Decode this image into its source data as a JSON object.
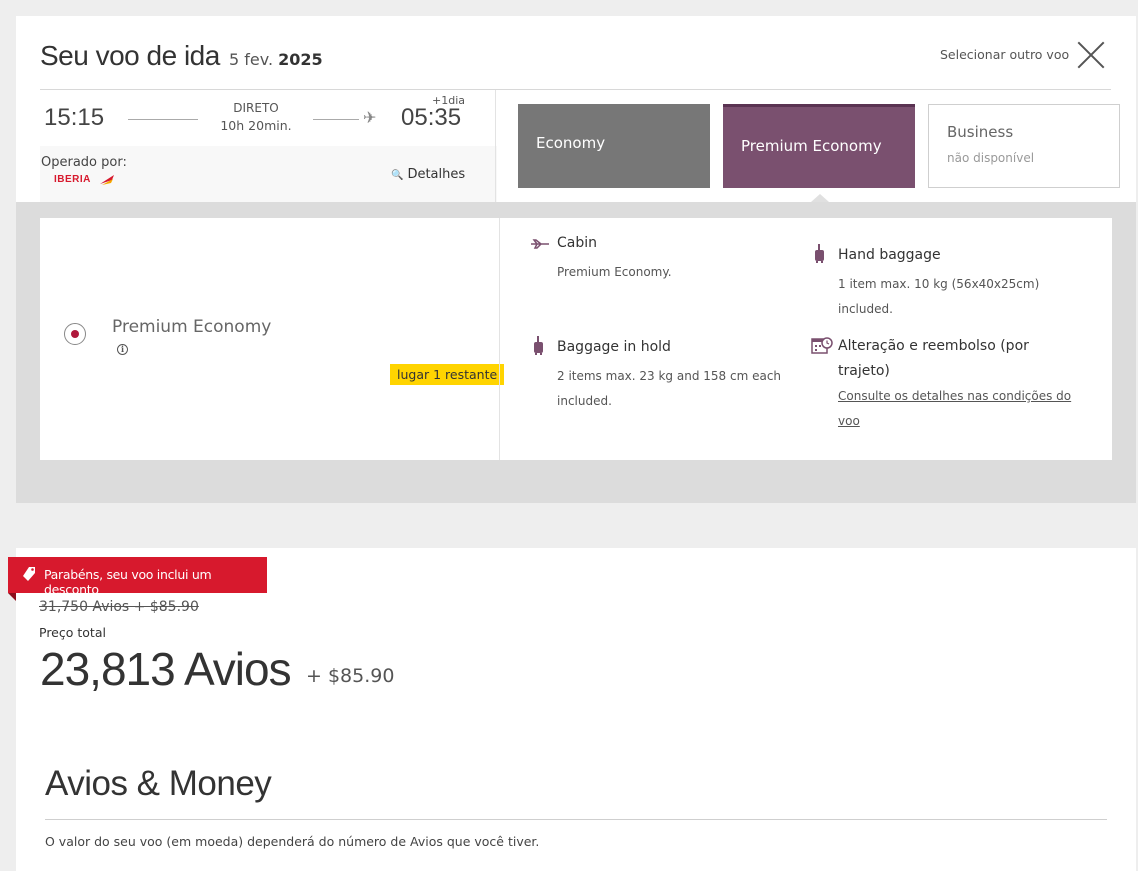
{
  "header": {
    "title": "Seu voo de ida",
    "date_prefix": "5 fev.",
    "date_year": "2025",
    "select_other": "Selecionar outro voo"
  },
  "flight": {
    "departure": "15:15",
    "arrival": "05:35",
    "stops": "DIRETO",
    "duration": "10h 20min.",
    "next_day": "+1dia",
    "operated_by": "Operado por:",
    "airline_logo_text": "IBERIA",
    "details_label": "Detalhes"
  },
  "fare_tabs": [
    {
      "label": "Economy",
      "sub": ""
    },
    {
      "label": "Premium Economy",
      "sub": ""
    },
    {
      "label": "Business",
      "sub": "não disponível"
    }
  ],
  "fare_detail": {
    "cabin_name": "Premium Economy",
    "seats_left": "lugar 1 restante",
    "features": {
      "cabin": {
        "title": "Cabin",
        "desc": "Premium Economy."
      },
      "hand_baggage": {
        "title": "Hand baggage",
        "desc1": "1 item max. 10 kg (56x40x25cm)",
        "desc2": "included."
      },
      "hold_baggage": {
        "title": "Baggage in hold",
        "desc1": "2 items max. 23 kg and 158 cm each",
        "desc2": "included."
      },
      "change_refund": {
        "title1": "Alteração e reembolso (por",
        "title2": "trajeto)",
        "link1": "Consulte os detalhes nas condições do",
        "link2": "voo"
      }
    }
  },
  "price": {
    "promo_banner": "Parabéns, seu voo inclui um desconto",
    "old_price": "31,750 Avios + $85.90",
    "total_label": "Preço total",
    "total_avios": "23,813 Avios",
    "total_money": "+ $85.90"
  },
  "avios_money": {
    "title": "Avios & Money",
    "description": "O valor do seu voo (em moeda) dependerá do número de Avios que você tiver."
  },
  "colors": {
    "brand_red": "#d7192d",
    "premium_purple": "#7a506f",
    "economy_grey": "#777777",
    "badge_yellow": "#ffd400"
  },
  "icons": [
    "close-icon",
    "plane-icon",
    "search-icon",
    "info-icon",
    "cabin-seat-icon",
    "suitcase-icon",
    "calendar-clock-icon",
    "price-tag-icon"
  ]
}
